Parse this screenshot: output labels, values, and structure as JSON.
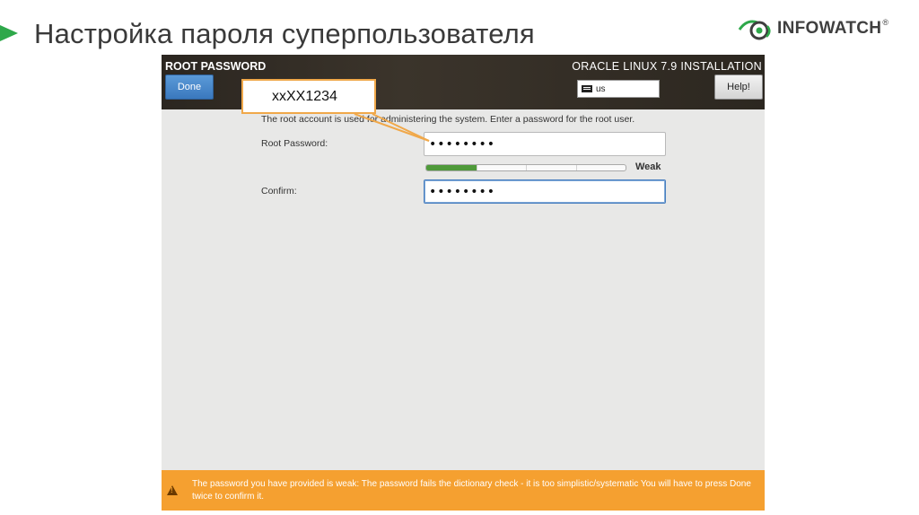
{
  "slide": {
    "title": "Настройка пароля суперпользователя",
    "logo_text": "INFOWATCH",
    "logo_mark": "®"
  },
  "installer": {
    "page_name": "ROOT PASSWORD",
    "install_name": "ORACLE LINUX 7.9 INSTALLATION",
    "done_label": "Done",
    "help_label": "Help!",
    "keyboard_layout": "us",
    "description": "The root account is used for administering the system.  Enter a password for the root user.",
    "root_password_label": "Root Password:",
    "root_password_value": "xxXX1234",
    "confirm_label": "Confirm:",
    "confirm_value": "xxXX1234",
    "strength_label": "Weak",
    "strength_fraction": 0.25,
    "warning_text": "The password you have provided is weak: The password fails the dictionary check - it is too simplistic/systematic You will have to press Done twice to confirm it."
  },
  "callout": {
    "text": "xxXX1234"
  },
  "colors": {
    "accent_green": "#2ea84a",
    "done_blue": "#3a78bd",
    "warning_orange": "#f5a030",
    "strength_green": "#4f9a3a",
    "callout_border": "#f0a84a"
  }
}
